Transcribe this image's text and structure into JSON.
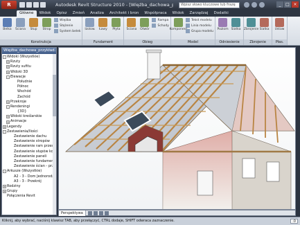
{
  "app": {
    "button": "R",
    "title": "Autodesk Revit Structure 2010 - [Więźba_dachowa_przykład...",
    "search_placeholder": "Wpisz słowo kluczowe lub frazę"
  },
  "tabs": [
    "Główne",
    "Widok",
    "Opisz",
    "Zmień",
    "Analiza",
    "Architekt i bron",
    "Współpraca",
    "Widok",
    "Zarządzaj",
    "Dodatki"
  ],
  "ribbon": {
    "groups": [
      {
        "label": "Konstrukcja",
        "tools": [
          "Belka",
          "Ściana",
          "Słup",
          "Strop"
        ],
        "small": [
          "Więźba",
          "Stężenie",
          "System belek"
        ]
      },
      {
        "label": "Fundament",
        "tools": [
          "Izolow.",
          "Ławy",
          "Płyta"
        ],
        "small": []
      },
      {
        "label": "Obieg",
        "tools": [
          "Ściana",
          "Otwór"
        ],
        "small": [
          "Rampa",
          "Schody"
        ]
      },
      {
        "label": "Model",
        "tools": [
          "Komponent"
        ],
        "small": [
          "Tekst modelu",
          "Linia modelu",
          "Grupa modelu"
        ]
      },
      {
        "label": "Odniesienie",
        "tools": [
          "Poziom",
          "Siatka"
        ],
        "small": []
      },
      {
        "label": "Zbrojenie",
        "tools": [
          "Zbrojenie",
          "Siatka"
        ],
        "small": []
      },
      {
        "label": "Płas.",
        "tools": [
          "Ustaw"
        ],
        "small": []
      }
    ]
  },
  "browser": {
    "title": "Więźba_dachowa_przykład...",
    "nodes": [
      {
        "label": "Widoki (Wszystkie)",
        "indent": 0,
        "toggle": "-"
      },
      {
        "label": "Rzuty",
        "indent": 1,
        "toggle": "+"
      },
      {
        "label": "Rzuty sufitu",
        "indent": 1,
        "toggle": "+"
      },
      {
        "label": "Widoki 3D",
        "indent": 1,
        "toggle": "+"
      },
      {
        "label": "Elewacje",
        "indent": 1,
        "toggle": "-"
      },
      {
        "label": "Południe",
        "indent": 3,
        "toggle": ""
      },
      {
        "label": "Północ",
        "indent": 3,
        "toggle": ""
      },
      {
        "label": "Wschód",
        "indent": 3,
        "toggle": ""
      },
      {
        "label": "Zachód",
        "indent": 3,
        "toggle": ""
      },
      {
        "label": "Przekroje",
        "indent": 1,
        "toggle": "+"
      },
      {
        "label": "Rendeningi",
        "indent": 1,
        "toggle": "-"
      },
      {
        "label": "{3D}",
        "indent": 3,
        "toggle": ""
      },
      {
        "label": "Widoki kreślarskie",
        "indent": 1,
        "toggle": "+"
      },
      {
        "label": "Animacje",
        "indent": 1,
        "toggle": "+"
      },
      {
        "label": "Legendy",
        "indent": 0,
        "toggle": "+"
      },
      {
        "label": "Zestawienia/Ilości",
        "indent": 0,
        "toggle": "-"
      },
      {
        "label": "Zestawienie dachu",
        "indent": 2,
        "toggle": ""
      },
      {
        "label": "Zestawienie stropów",
        "indent": 2,
        "toggle": ""
      },
      {
        "label": "Zestawienie ram przestrz",
        "indent": 2,
        "toggle": ""
      },
      {
        "label": "Zestawienie słupów konstr",
        "indent": 2,
        "toggle": ""
      },
      {
        "label": "Zestawienie paneli",
        "indent": 2,
        "toggle": ""
      },
      {
        "label": "Zestawienie fundamentów",
        "indent": 2,
        "toggle": ""
      },
      {
        "label": "Zestawienie ścian - przekr",
        "indent": 2,
        "toggle": ""
      },
      {
        "label": "Arkusze (Wszystkie)",
        "indent": 0,
        "toggle": "-"
      },
      {
        "label": "A2 - 3 - Dom Jednorodzinny",
        "indent": 2,
        "toggle": ""
      },
      {
        "label": "A3 - 3 - Przekrój",
        "indent": 2,
        "toggle": ""
      },
      {
        "label": "Rodziny",
        "indent": 0,
        "toggle": "+"
      },
      {
        "label": "Grupy",
        "indent": 0,
        "toggle": "+"
      },
      {
        "label": "Połączenia Revit",
        "indent": 0,
        "toggle": ""
      }
    ]
  },
  "viewbar": {
    "name": "Perspektywa"
  },
  "status": {
    "text": "Kliknij, aby wybrać, naciśnij klawisz TAB, aby przełączyć, CTRL dodaje, SHIFT odwraca zaznaczenie.",
    "right": ":0"
  },
  "colors": {
    "accent": "#3f5a86",
    "brand": "#b8382a"
  }
}
